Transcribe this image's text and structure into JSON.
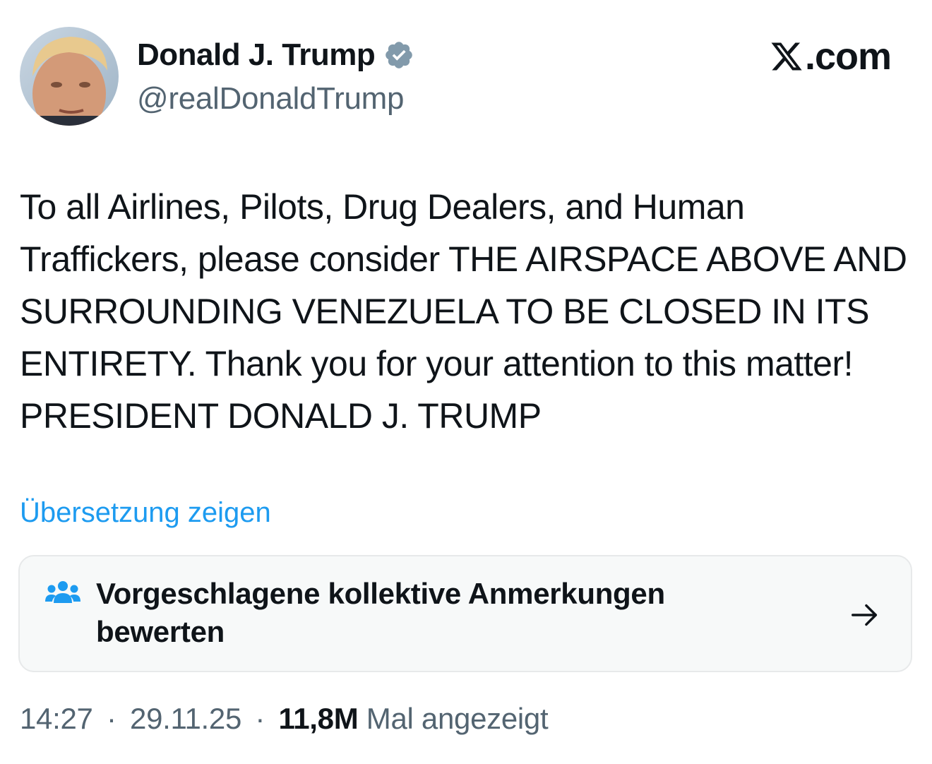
{
  "author": {
    "name": "Donald J. Trump",
    "handle": "@realDonaldTrump",
    "verified_icon": "verified-badge-icon",
    "verified_color": "#829aab"
  },
  "brand": {
    "label": ".com",
    "logo_icon": "x-logo-icon"
  },
  "tweet": {
    "text": "To all Airlines, Pilots, Drug Dealers, and Human Traffickers, please consider THE AIRSPACE ABOVE AND SURROUNDING VENEZUELA TO BE CLOSED IN ITS ENTIRETY. Thank you for your attention to this matter! PRESIDENT DONALD J. TRUMP"
  },
  "translate": {
    "label": "Übersetzung zeigen",
    "color": "#1d9bf0"
  },
  "community_notes": {
    "label": "Vorgeschlagene kollektive Anmerkungen bewerten",
    "icon": "people-icon",
    "arrow_icon": "arrow-right-icon",
    "icon_color": "#1d9bf0"
  },
  "meta": {
    "time": "14:27",
    "date": "29.11.25",
    "separator": "·",
    "views_count": "11,8M",
    "views_label": "Mal angezeigt"
  }
}
